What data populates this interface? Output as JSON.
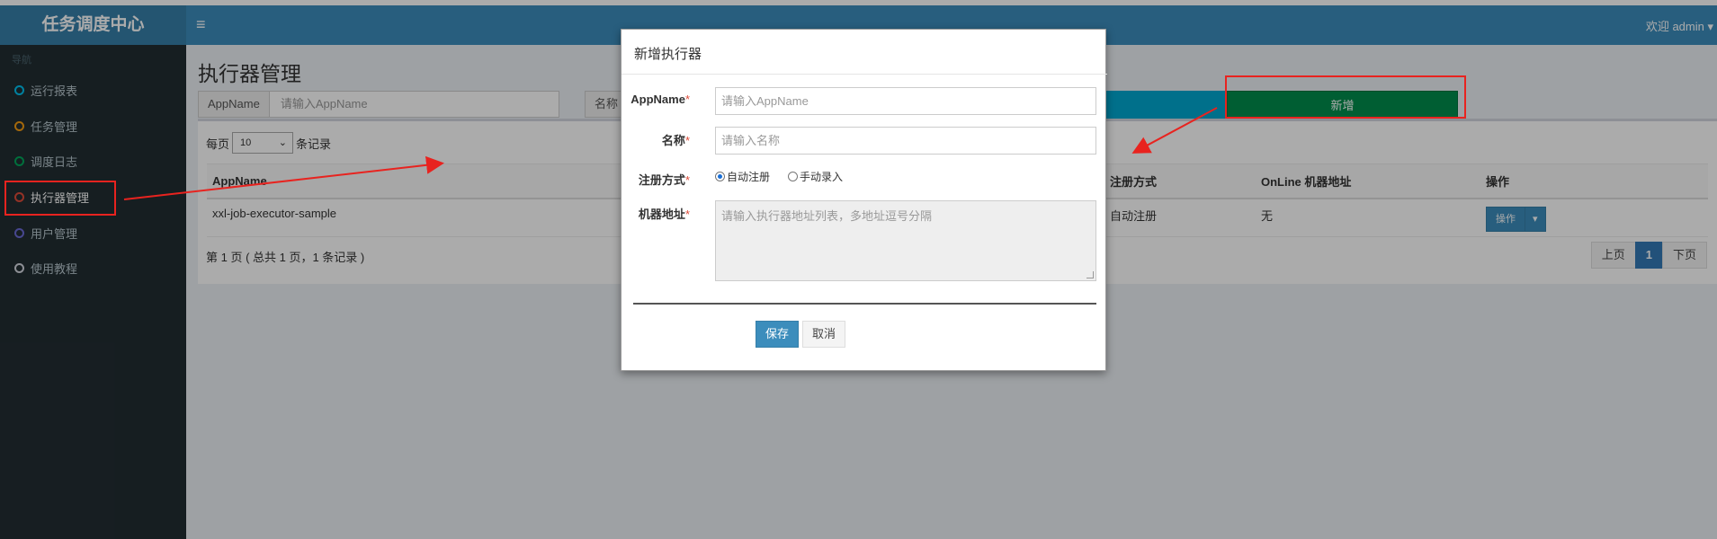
{
  "app": {
    "logo": "任务调度中心",
    "menu_icon": "bars-icon",
    "welcome": "欢迎 admin ▾"
  },
  "sidebar": {
    "header": "导航",
    "items": [
      {
        "label": "运行报表",
        "color": "#00c0ef"
      },
      {
        "label": "任务管理",
        "color": "#f39c12"
      },
      {
        "label": "调度日志",
        "color": "#00a65a"
      },
      {
        "label": "执行器管理",
        "color": "#dd4b39"
      },
      {
        "label": "用户管理",
        "color": "#6b6bd6"
      },
      {
        "label": "使用教程",
        "color": "#d2d6de"
      }
    ],
    "active": "执行器管理"
  },
  "main": {
    "title": "执行器管理",
    "search": {
      "appname_label": "AppName",
      "appname_placeholder": "请输入AppName",
      "title_label": "名称"
    },
    "add_button": "新增",
    "perpage_prefix": "每页",
    "perpage_value": "10",
    "perpage_suffix": "条记录",
    "table": {
      "headers": [
        "AppName",
        "注册方式",
        "OnLine 机器地址",
        "操作"
      ],
      "rows": [
        {
          "appname": "xxl-job-executor-sample",
          "reg": "自动注册",
          "online": "无",
          "op": "操作"
        }
      ]
    },
    "info": "第 1 页 ( 总共 1 页，1 条记录 )",
    "pager": {
      "prev": "上页",
      "current": "1",
      "next": "下页"
    }
  },
  "modal": {
    "title": "新增执行器",
    "appname_label": "AppName",
    "appname_placeholder": "请输入AppName",
    "name_label": "名称",
    "name_placeholder": "请输入名称",
    "reg_label": "注册方式",
    "reg_auto": "自动注册",
    "reg_manual": "手动录入",
    "reg_selected": "自动注册",
    "addr_label": "机器地址",
    "addr_placeholder": "请输入执行器地址列表，多地址逗号分隔",
    "required_mark": "*",
    "save": "保存",
    "cancel": "取消"
  },
  "annotation_color": "#e8231f"
}
